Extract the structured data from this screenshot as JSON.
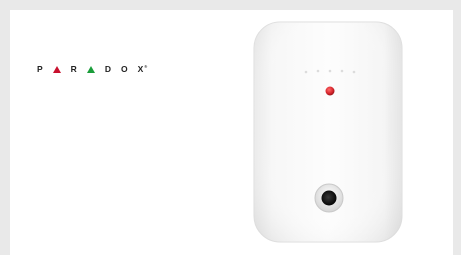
{
  "brand": {
    "letters": [
      "P",
      "R",
      "D",
      "O",
      "X"
    ],
    "mark": "®",
    "accent_red": "#c8102e",
    "accent_green": "#1a9d3a"
  },
  "product": {
    "icon": "glass-break-detector",
    "led_color": "#d8262d"
  }
}
